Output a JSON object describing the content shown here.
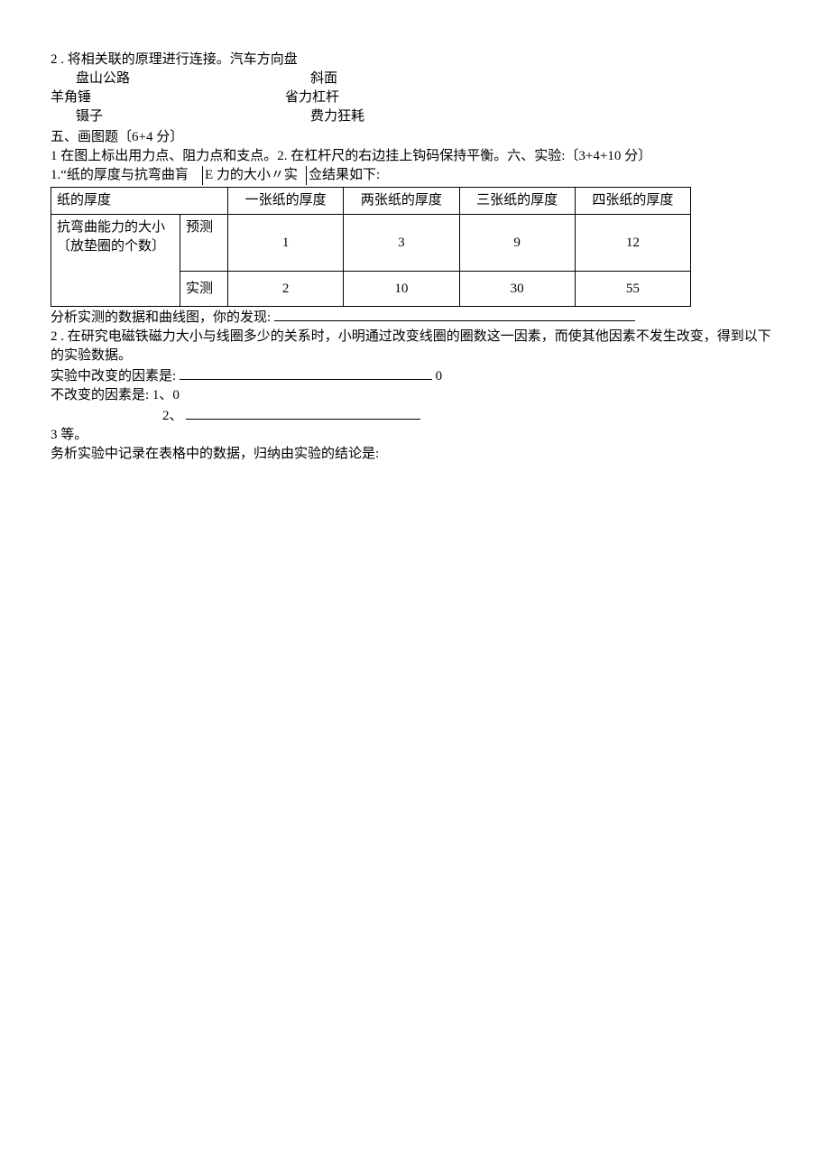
{
  "q2": {
    "intro": "2  . 将相关联的原理进行连接。汽车方向盘",
    "pairs": [
      {
        "left": "盘山公路",
        "right": "斜面"
      },
      {
        "left": "羊角锤",
        "right": "省力杠杆"
      },
      {
        "left": "镊子",
        "right": "费力狂耗"
      }
    ]
  },
  "sec5_title": "五、画图题〔6+4 分〕",
  "sec5_q1": "  1 在图上标出用力点、阻力点和支点。2. 在杠杆尺的右边挂上钩码保持平衡。六、实验:〔3+4+10 分〕",
  "exp1_intro_a": "1.“纸的厚度与抗弯曲肓",
  "exp1_intro_b": "E 力的大小〃实",
  "exp1_intro_c": "佥结果如下:",
  "table": {
    "headers": [
      "纸的厚度",
      "一张纸的厚度",
      "两张纸的厚度",
      "三张纸的厚度",
      "四张纸的厚度"
    ],
    "row_label": "抗弯曲能力的大小〔放垫圈的个数〕",
    "predict_label": "预测",
    "measure_label": "实测",
    "predict": [
      "1",
      "3",
      "9",
      "12"
    ],
    "measure": [
      "2",
      "10",
      "30",
      "55"
    ]
  },
  "analysis_line": "分析实测的数据和曲线图，你的发现:",
  "exp2_intro": "2    . 在研究电磁铁磁力大小与线圈多少的关系时，小明通过改变线圈的圈数这一因素，而使其他因素不发生改变，得到以下的实验数据。",
  "changed_label": "实验中改变的因素是:",
  "changed_tail": "0",
  "unchanged_label": "不改变的因素是: 1、0",
  "unchanged_2": "2、",
  "line3": "3  等。",
  "conclusion": "务析实验中记录在表格中的数据，归纳由实验的结论是:"
}
